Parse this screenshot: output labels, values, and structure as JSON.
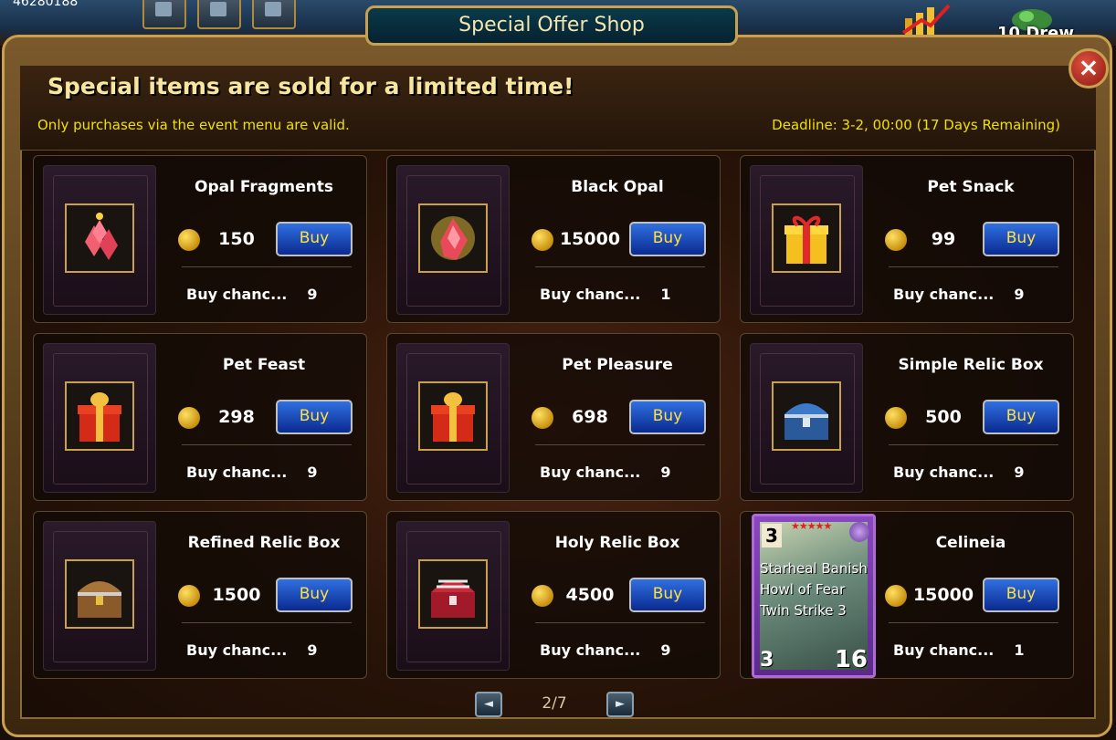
{
  "topbar": {
    "resource_value": "46280188",
    "draw_label": "10 Drew"
  },
  "window": {
    "title": "Special Offer Shop",
    "close_label": "×",
    "headline": "Special items are sold for a limited time!",
    "notice": "Only purchases via the event menu are valid.",
    "deadline": "Deadline: 3-2, 00:00 (17 Days Remaining)"
  },
  "items": [
    {
      "name": "Opal Fragments",
      "price": "150",
      "buy_label": "Buy",
      "chance_label": "Buy chanc...",
      "chance": "9",
      "icon": "opal-fragments-icon"
    },
    {
      "name": "Black Opal",
      "price": "15000",
      "buy_label": "Buy",
      "chance_label": "Buy chanc...",
      "chance": "1",
      "icon": "black-opal-icon"
    },
    {
      "name": "Pet Snack",
      "price": "99",
      "buy_label": "Buy",
      "chance_label": "Buy chanc...",
      "chance": "9",
      "icon": "gift-box-icon"
    },
    {
      "name": "Pet Feast",
      "price": "298",
      "buy_label": "Buy",
      "chance_label": "Buy chanc...",
      "chance": "9",
      "icon": "red-gift-box-icon"
    },
    {
      "name": "Pet Pleasure",
      "price": "698",
      "buy_label": "Buy",
      "chance_label": "Buy chanc...",
      "chance": "9",
      "icon": "red-gift-box-icon"
    },
    {
      "name": "Simple Relic Box",
      "price": "500",
      "buy_label": "Buy",
      "chance_label": "Buy chanc...",
      "chance": "9",
      "icon": "blue-chest-icon"
    },
    {
      "name": "Refined Relic Box",
      "price": "1500",
      "buy_label": "Buy",
      "chance_label": "Buy chanc...",
      "chance": "9",
      "icon": "wooden-chest-icon"
    },
    {
      "name": "Holy Relic Box",
      "price": "4500",
      "buy_label": "Buy",
      "chance_label": "Buy chanc...",
      "chance": "9",
      "icon": "red-chest-icon"
    },
    {
      "name": "Celineia",
      "price": "15000",
      "buy_label": "Buy",
      "chance_label": "Buy chanc...",
      "chance": "1",
      "icon": "hero-card-art",
      "card": {
        "level": "3",
        "skills": "Starheal Banish Howl of Fear Twin Strike 3",
        "cost": "3",
        "attack": "16"
      }
    }
  ],
  "pager": {
    "prev_label": "◄",
    "text": "2/7",
    "next_label": "►"
  },
  "colors": {
    "accent_gold": "#c8a050",
    "notice_yellow": "#f0e000",
    "buy_blue": "#1a4ac0"
  }
}
